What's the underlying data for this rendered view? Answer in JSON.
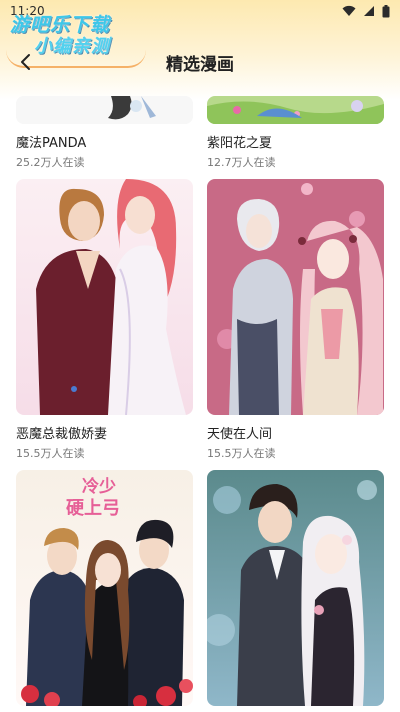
{
  "status_bar": {
    "time": "11:20",
    "icons": [
      "wifi-icon",
      "signal-icon",
      "battery-icon"
    ]
  },
  "watermark": {
    "line1": "游吧乐下载",
    "line2": "小编亲测"
  },
  "header": {
    "title": "精选漫画",
    "back_icon": "chevron-left-icon"
  },
  "comics": [
    {
      "title": "魔法PANDA",
      "readers": "25.2万人在读"
    },
    {
      "title": "紫阳花之夏",
      "readers": "12.7万人在读"
    },
    {
      "title": "恶魔总裁傲娇妻",
      "readers": "15.5万人在读"
    },
    {
      "title": "天使在人间",
      "readers": "15.5万人在读"
    },
    {
      "title": "",
      "readers": "",
      "cover_text": "冷少 硬上弓"
    },
    {
      "title": "",
      "readers": ""
    }
  ],
  "colors": {
    "header_gradient_top": "#fde9b0",
    "watermark_blue": "#3ec7e8",
    "text_primary": "#222222",
    "text_secondary": "#777777"
  }
}
